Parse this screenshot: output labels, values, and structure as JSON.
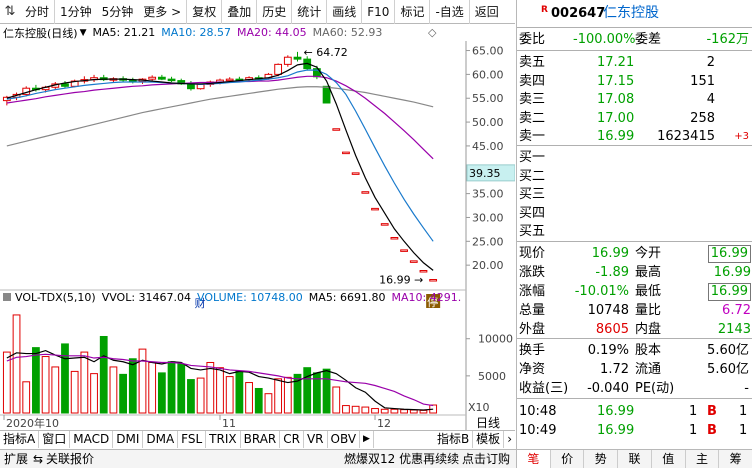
{
  "toolbar": {
    "items": [
      "分时",
      "1分钟",
      "5分钟",
      "更多",
      "复权",
      "叠加",
      "历史",
      "统计",
      "画线",
      "F10",
      "标记",
      "-自选",
      "返回"
    ]
  },
  "chart": {
    "title": "仁东控股(日线)",
    "ma5": "MA5: 21.21",
    "ma10": "MA10: 28.57",
    "ma20": "MA20: 44.05",
    "ma60": "MA60: 52.93",
    "high_label": "64.72",
    "low_label": "16.99",
    "cursor_price": "39.35",
    "y_ticks": [
      "65.00",
      "60.00",
      "55.00",
      "50.00",
      "45.00",
      "40.00",
      "35.00",
      "30.00",
      "25.00",
      "20.00"
    ],
    "marker_cai": "财",
    "marker_ting": "停"
  },
  "volume": {
    "title": "VOL-TDX(5,10)",
    "vvol": "VVOL: 31467.04",
    "volume": "VOLUME: 10748.00",
    "ma5": "MA5: 6691.80",
    "ma10": "MA10: 4291.",
    "y_ticks": [
      "10000",
      "5000"
    ],
    "unit": "X10"
  },
  "time_axis": {
    "labels": [
      "2020年10",
      "11",
      "12"
    ],
    "period": "日线"
  },
  "tabs": [
    "指标A",
    "窗口",
    "MACD",
    "DMI",
    "DMA",
    "FSL",
    "TRIX",
    "BRAR",
    "CR",
    "VR",
    "OBV",
    "指标B",
    "模板"
  ],
  "statusbar": {
    "expand": "扩展",
    "linked": "关联报价",
    "ad": "燃爆双12 优惠再续续",
    "subscribe": "点击订购"
  },
  "quote": {
    "r_badge": "R",
    "code": "002647",
    "name": "仁东控股",
    "webi_label": "委比",
    "webi_value": "-100.00%",
    "weicha_label": "委差",
    "weicha_value": "-162万",
    "asks": [
      {
        "label": "卖五",
        "price": "17.21",
        "vol": "2",
        "chg": ""
      },
      {
        "label": "卖四",
        "price": "17.15",
        "vol": "151",
        "chg": ""
      },
      {
        "label": "卖三",
        "price": "17.08",
        "vol": "4",
        "chg": ""
      },
      {
        "label": "卖二",
        "price": "17.00",
        "vol": "258",
        "chg": ""
      },
      {
        "label": "卖一",
        "price": "16.99",
        "vol": "1623415",
        "chg": "+3"
      }
    ],
    "bids": [
      "买一",
      "买二",
      "买三",
      "买四",
      "买五"
    ],
    "stats": [
      {
        "l1": "现价",
        "v1": "16.99",
        "l2": "今开",
        "v2": "16.99"
      },
      {
        "l1": "涨跌",
        "v1": "-1.89",
        "l2": "最高",
        "v2": "16.99"
      },
      {
        "l1": "涨幅",
        "v1": "-10.01%",
        "l2": "最低",
        "v2": "16.99"
      },
      {
        "l1": "总量",
        "v1": "10748",
        "l2": "量比",
        "v2": "6.72"
      },
      {
        "l1": "外盘",
        "v1": "8605",
        "l2": "内盘",
        "v2": "2143"
      }
    ],
    "stats2": [
      {
        "l1": "换手",
        "v1": "0.19%",
        "l2": "股本",
        "v2": "5.60亿"
      },
      {
        "l1": "净资",
        "v1": "1.72",
        "l2": "流通",
        "v2": "5.60亿"
      },
      {
        "l1": "收益(三)",
        "v1": "-0.040",
        "l2": "PE(动)",
        "v2": "-"
      }
    ],
    "ticks": [
      {
        "time": "10:48",
        "price": "16.99",
        "vol": "1",
        "side": "B",
        "num": "1"
      },
      {
        "time": "10:49",
        "price": "16.99",
        "vol": "1",
        "side": "B",
        "num": "1"
      }
    ],
    "bottom_tabs": [
      "笔",
      "价",
      "势",
      "联",
      "值",
      "主",
      "筹"
    ]
  },
  "chart_data": {
    "type": "candlestick",
    "ylim": [
      15,
      67
    ],
    "candles": [
      [
        54.5,
        55.5,
        53.5,
        55.2
      ],
      [
        55.2,
        56.2,
        54.6,
        55.8
      ],
      [
        55.8,
        57.5,
        55.4,
        57.1
      ],
      [
        57.1,
        57.8,
        56.4,
        56.8
      ],
      [
        56.8,
        57.6,
        56.2,
        57.3
      ],
      [
        57.3,
        58.4,
        56.9,
        58.0
      ],
      [
        58.0,
        58.6,
        57.2,
        57.5
      ],
      [
        57.5,
        58.9,
        57.3,
        58.6
      ],
      [
        58.6,
        59.6,
        58.1,
        58.9
      ],
      [
        58.9,
        59.9,
        58.4,
        59.3
      ],
      [
        59.3,
        59.9,
        58.6,
        58.9
      ],
      [
        58.9,
        59.4,
        58.2,
        59.1
      ],
      [
        59.1,
        59.6,
        58.5,
        58.8
      ],
      [
        58.8,
        59.3,
        58.1,
        58.5
      ],
      [
        58.5,
        59.2,
        58.0,
        59.0
      ],
      [
        59.0,
        59.8,
        58.6,
        59.4
      ],
      [
        59.4,
        59.9,
        58.8,
        59.0
      ],
      [
        59.0,
        59.5,
        58.4,
        58.7
      ],
      [
        58.7,
        59.1,
        57.8,
        58.0
      ],
      [
        58.0,
        58.6,
        56.6,
        57.0
      ],
      [
        57.0,
        58.1,
        56.8,
        57.9
      ],
      [
        57.9,
        58.7,
        57.4,
        58.4
      ],
      [
        58.4,
        59.1,
        57.9,
        58.8
      ],
      [
        58.8,
        59.4,
        58.3,
        59.0
      ],
      [
        59.0,
        59.5,
        58.6,
        58.9
      ],
      [
        58.9,
        59.6,
        58.5,
        59.3
      ],
      [
        59.3,
        59.8,
        58.9,
        59.2
      ],
      [
        59.2,
        60.3,
        58.9,
        60.0
      ],
      [
        60.0,
        62.3,
        59.6,
        62.1
      ],
      [
        62.1,
        64.0,
        61.6,
        63.6
      ],
      [
        63.6,
        64.72,
        62.7,
        63.2
      ],
      [
        63.2,
        63.8,
        60.8,
        61.2
      ],
      [
        61.2,
        61.8,
        59.0,
        59.5
      ],
      [
        57.5,
        57.5,
        54.0,
        54.0
      ],
      [
        48.6,
        48.6,
        48.6,
        48.6
      ],
      [
        43.7,
        43.7,
        43.7,
        43.7
      ],
      [
        39.35,
        39.35,
        39.35,
        39.35
      ],
      [
        35.4,
        35.4,
        35.4,
        35.4
      ],
      [
        31.9,
        31.9,
        31.9,
        31.9
      ],
      [
        28.7,
        28.7,
        28.7,
        28.7
      ],
      [
        25.8,
        25.8,
        25.8,
        25.8
      ],
      [
        23.2,
        23.2,
        23.2,
        23.2
      ],
      [
        20.9,
        20.9,
        20.9,
        20.9
      ],
      [
        18.88,
        18.88,
        18.88,
        18.88
      ],
      [
        16.99,
        16.99,
        16.99,
        16.99
      ]
    ],
    "volumes": [
      8200,
      13200,
      4200,
      8800,
      7600,
      6200,
      9300,
      5600,
      8200,
      5300,
      10300,
      6200,
      5200,
      7300,
      8600,
      6800,
      5400,
      6900,
      6600,
      4500,
      4700,
      6800,
      6100,
      4900,
      5600,
      4100,
      3300,
      2600,
      4600,
      4800,
      5200,
      6100,
      5400,
      5900,
      3500,
      1000,
      900,
      800,
      600,
      500,
      500,
      450,
      400,
      350,
      1075
    ],
    "ma5": [
      55.0,
      55.6,
      56.2,
      56.8,
      57.3,
      57.8,
      58.2,
      58.5,
      58.7,
      58.9,
      59.0,
      59.0,
      59.0,
      58.9,
      58.8,
      58.6,
      58.4,
      58.2,
      58.1,
      58.0,
      58.0,
      58.1,
      58.3,
      58.5,
      58.7,
      58.9,
      59.1,
      59.3,
      59.8,
      60.8,
      62.0,
      62.3,
      61.5,
      58.6,
      53.8,
      48.3,
      43.0,
      38.3,
      34.2,
      30.9,
      27.6,
      25.0,
      22.6,
      20.5,
      18.9
    ],
    "ma10": [
      54.8,
      55.1,
      55.5,
      56.0,
      56.4,
      56.8,
      57.1,
      57.4,
      57.7,
      57.9,
      58.1,
      58.3,
      58.4,
      58.4,
      58.4,
      58.4,
      58.3,
      58.2,
      58.1,
      58.0,
      57.9,
      58.0,
      58.1,
      58.3,
      58.4,
      58.6,
      58.8,
      59.0,
      59.3,
      59.7,
      60.5,
      60.9,
      60.9,
      60.0,
      58.3,
      55.8,
      52.3,
      48.5,
      44.6,
      40.8,
      37.2,
      33.8,
      30.7,
      27.8,
      25.0
    ],
    "ma20": [
      54.0,
      54.3,
      54.6,
      54.9,
      55.3,
      55.6,
      55.9,
      56.2,
      56.4,
      56.7,
      56.9,
      57.1,
      57.3,
      57.5,
      57.6,
      57.8,
      57.9,
      58.0,
      58.1,
      58.2,
      58.3,
      58.3,
      58.4,
      58.4,
      58.5,
      58.5,
      58.6,
      58.6,
      58.8,
      59.1,
      59.4,
      59.6,
      59.6,
      59.3,
      58.6,
      57.6,
      56.4,
      55.0,
      53.4,
      51.8,
      50.0,
      48.2,
      46.3,
      44.3,
      42.3
    ],
    "ma60": [
      45.0,
      45.5,
      46.0,
      46.5,
      47.0,
      47.5,
      48.0,
      48.5,
      49.0,
      49.5,
      50.0,
      50.5,
      51.0,
      51.5,
      52.0,
      52.4,
      52.8,
      53.2,
      53.6,
      54.0,
      54.4,
      54.8,
      55.1,
      55.4,
      55.7,
      56.0,
      56.3,
      56.6,
      56.9,
      57.1,
      57.3,
      57.4,
      57.4,
      57.3,
      57.1,
      56.8,
      56.5,
      56.2,
      55.8,
      55.4,
      55.0,
      54.6,
      54.2,
      53.7,
      53.2
    ],
    "vol_ma5": [
      7400,
      8100,
      8000,
      8000,
      8400,
      7800,
      7300,
      7400,
      7500,
      6900,
      7700,
      7100,
      6900,
      6500,
      7100,
      6800,
      6600,
      6900,
      6800,
      6000,
      5800,
      6000,
      5800,
      5300,
      5600,
      5500,
      4900,
      4700,
      4400,
      4100,
      4300,
      4900,
      5400,
      5700,
      5300,
      4400,
      3400,
      2800,
      1600,
      700,
      600,
      500,
      450,
      400,
      510
    ],
    "vol_ma10": [
      7000,
      7500,
      7600,
      7800,
      7900,
      7800,
      7700,
      7700,
      7700,
      7400,
      7500,
      7300,
      7200,
      7000,
      7000,
      6900,
      6800,
      6800,
      6700,
      6400,
      6300,
      6200,
      6000,
      5800,
      5700,
      5600,
      5400,
      5200,
      5000,
      4700,
      4600,
      4600,
      4600,
      4600,
      4400,
      4200,
      4100,
      4000,
      3700,
      3300,
      2900,
      2300,
      1800,
      1200,
      1000
    ],
    "x_labels": [
      "2020年10",
      "11",
      "12"
    ]
  }
}
